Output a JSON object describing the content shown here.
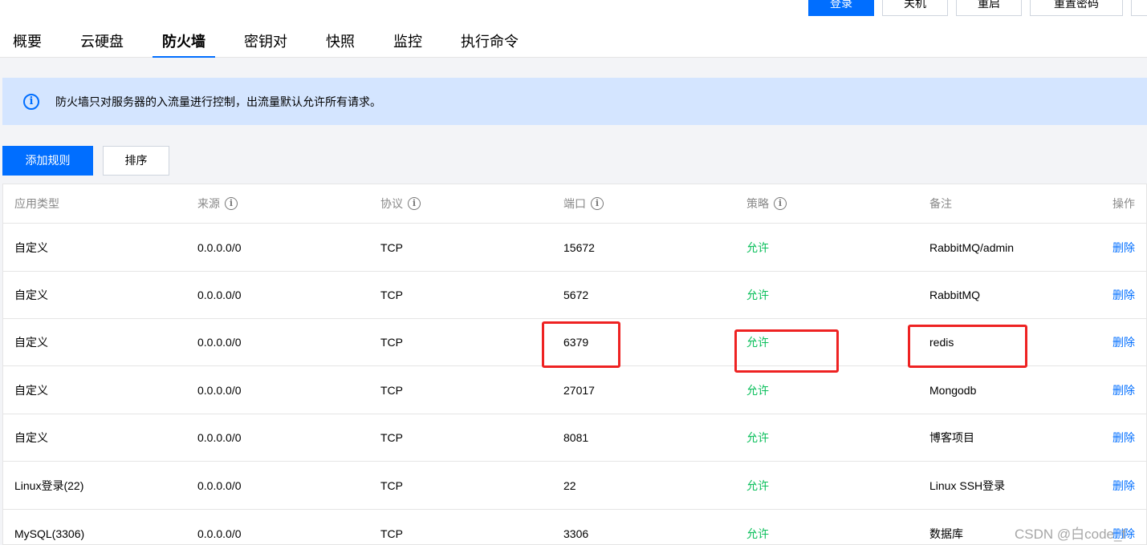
{
  "top_actions": [
    "登录",
    "关机",
    "重启",
    "重置密码"
  ],
  "tabs": [
    "概要",
    "云硬盘",
    "防火墙",
    "密钥对",
    "快照",
    "监控",
    "执行命令"
  ],
  "active_tab": "防火墙",
  "notice": {
    "icon": "info-icon",
    "text": "防火墙只对服务器的入流量进行控制，出流量默认允许所有请求。"
  },
  "toolbar": {
    "add_rule": "添加规则",
    "sort": "排序"
  },
  "table": {
    "headers": [
      "应用类型",
      "来源",
      "协议",
      "端口",
      "策略",
      "备注",
      "操作"
    ],
    "rows": [
      {
        "type": "自定义",
        "source": "0.0.0.0/0",
        "protocol": "TCP",
        "port": "15672",
        "policy": "允许",
        "remark": "RabbitMQ/admin",
        "action": "删除"
      },
      {
        "type": "自定义",
        "source": "0.0.0.0/0",
        "protocol": "TCP",
        "port": "5672",
        "policy": "允许",
        "remark": "RabbitMQ",
        "action": "删除"
      },
      {
        "type": "自定义",
        "source": "0.0.0.0/0",
        "protocol": "TCP",
        "port": "6379",
        "policy": "允许",
        "remark": "redis",
        "action": "删除"
      },
      {
        "type": "自定义",
        "source": "0.0.0.0/0",
        "protocol": "TCP",
        "port": "27017",
        "policy": "允许",
        "remark": "Mongodb",
        "action": "删除"
      },
      {
        "type": "自定义",
        "source": "0.0.0.0/0",
        "protocol": "TCP",
        "port": "8081",
        "policy": "允许",
        "remark": "博客项目",
        "action": "删除"
      },
      {
        "type": "Linux登录(22)",
        "source": "0.0.0.0/0",
        "protocol": "TCP",
        "port": "22",
        "policy": "允许",
        "remark": "Linux SSH登录",
        "action": "删除"
      },
      {
        "type": "MySQL(3306)",
        "source": "0.0.0.0/0",
        "protocol": "TCP",
        "port": "3306",
        "policy": "允许",
        "remark": "数据库",
        "action": "删除"
      }
    ]
  },
  "colors": {
    "primary": "#006eff",
    "allow": "#0abf5b",
    "highlight": "#ee2222",
    "notice_bg": "#d4e5ff"
  },
  "watermark": "CSDN @白code_f"
}
